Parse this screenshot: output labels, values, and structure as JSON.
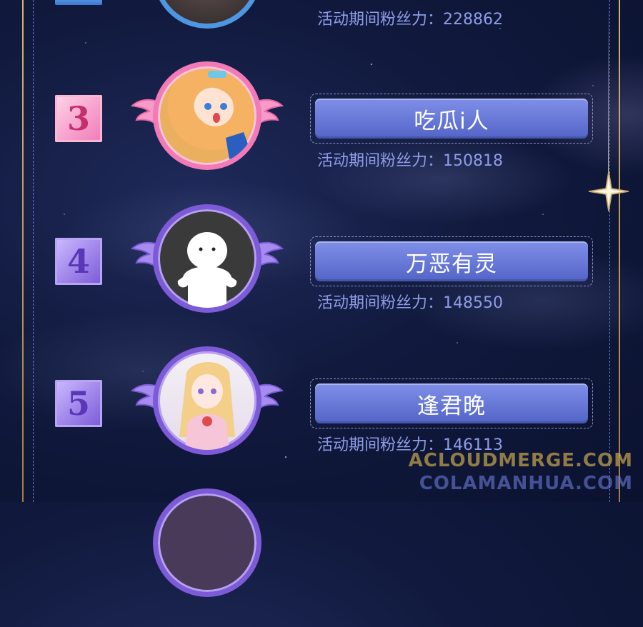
{
  "entries": [
    {
      "rank": "",
      "name": "",
      "fans_label": "活动期间粉丝力：",
      "fans_value": "228862",
      "style": "blue"
    },
    {
      "rank": "3",
      "name": "吃瓜i人",
      "fans_label": "活动期间粉丝力：",
      "fans_value": "150818",
      "style": "pink"
    },
    {
      "rank": "4",
      "name": "万恶有灵",
      "fans_label": "活动期间粉丝力：",
      "fans_value": "148550",
      "style": "purple"
    },
    {
      "rank": "5",
      "name": "逢君晚",
      "fans_label": "活动期间粉丝力：",
      "fans_value": "146113",
      "style": "purple"
    }
  ],
  "watermark": {
    "line1": "ACLOUDMERGE.COM",
    "line2": "COLAMANHUA.COM"
  },
  "colors": {
    "pink": "#f27ab6",
    "purple": "#7d5ad8",
    "button": "#5f70d4",
    "fans_text": "#8f9ce8",
    "frame_gold": "#d9b26a"
  }
}
